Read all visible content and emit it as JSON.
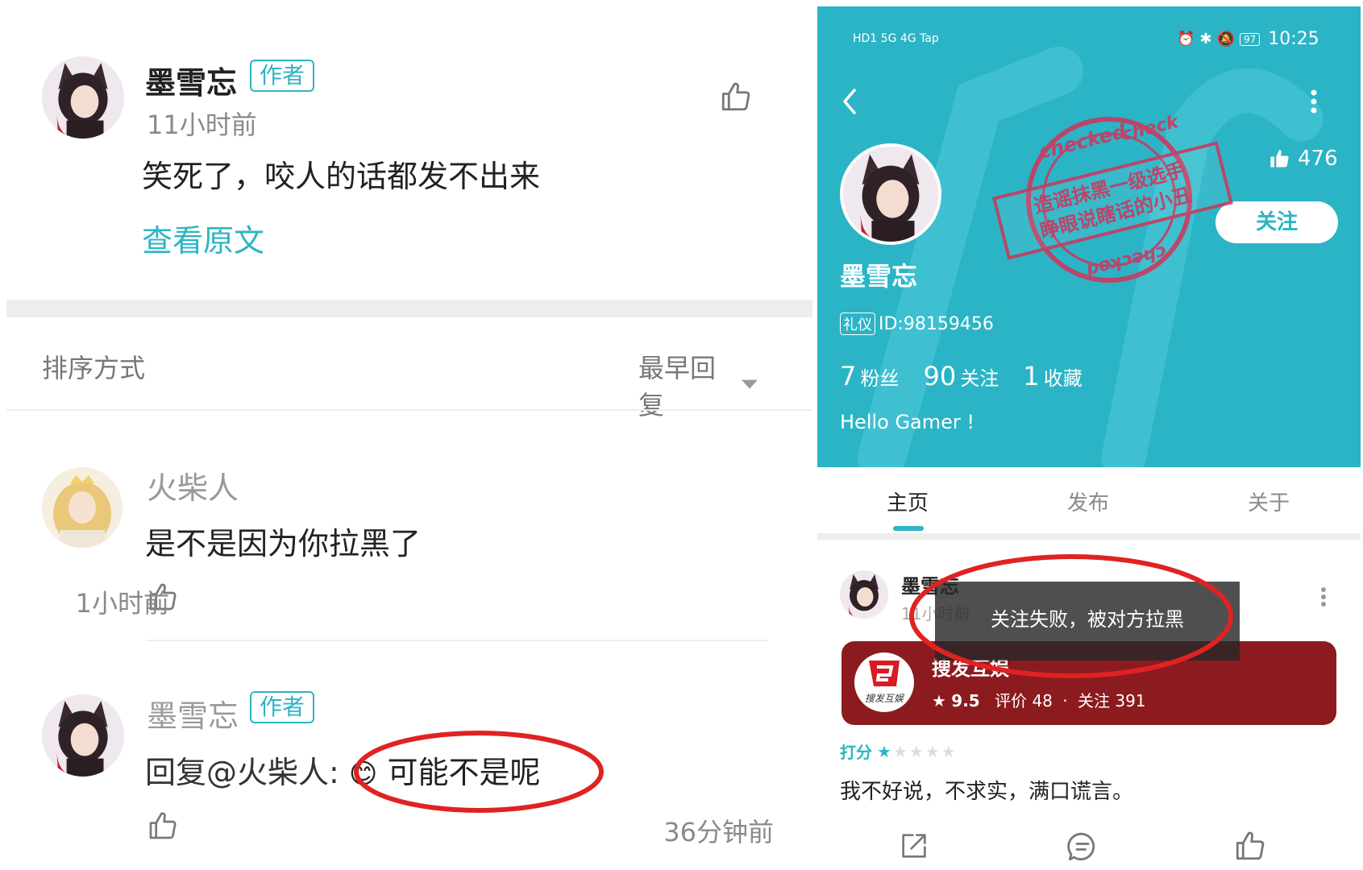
{
  "left": {
    "main_comment": {
      "author": "墨雪忘",
      "author_badge": "作者",
      "time": "11小时前",
      "text": "笑死了，咬人的话都发不出来",
      "view_original": "查看原文"
    },
    "sort": {
      "label": "排序方式",
      "value": "最早回复"
    },
    "replies": [
      {
        "author": "火柴人",
        "text": "是不是因为你拉黑了",
        "time": "1小时前"
      },
      {
        "author": "墨雪忘",
        "author_badge": "作者",
        "text_prefix": "回复@火柴人:",
        "emoji": "😊",
        "text": "可能不是呢",
        "time": "36分钟前"
      }
    ]
  },
  "right": {
    "status_bar": {
      "left": "HD1 5G 4G Tap",
      "battery": "97",
      "time": "10:25"
    },
    "profile": {
      "name": "墨雪忘",
      "likes": "476",
      "follow_button": "关注",
      "id_badge": "礼仪",
      "id": "ID:98159456",
      "fans_count": "7",
      "fans_label": "粉丝",
      "following_count": "90",
      "following_label": "关注",
      "favorites_count": "1",
      "favorites_label": "收藏",
      "bio": "Hello Gamer !"
    },
    "stamp": {
      "ring_top": "checked",
      "ring_top_right": "check",
      "ring_bottom": "checked",
      "line1": "造谣抹黑一级选手",
      "line2": "睁眼说瞎话的小丑"
    },
    "tabs": [
      "主页",
      "发布",
      "关于"
    ],
    "post": {
      "author": "墨雪忘",
      "time": "11小时前",
      "toast": "关注失败，被对方拉黑",
      "game_name": "搜发互娱",
      "game_logo_text": "搜发互娱",
      "game_rating": "9.5",
      "game_reviews": "评价 48",
      "game_follows": "关注 391",
      "score_label": "打分",
      "stars_filled": 1,
      "stars_total": 5,
      "text": "我不好说，不求实，满口谎言。"
    }
  },
  "colors": {
    "accent": "#2bb5c4",
    "profile_bg": "#2bb4c6",
    "annotation_red": "#e02222",
    "game_card": "#8c1b1f"
  }
}
